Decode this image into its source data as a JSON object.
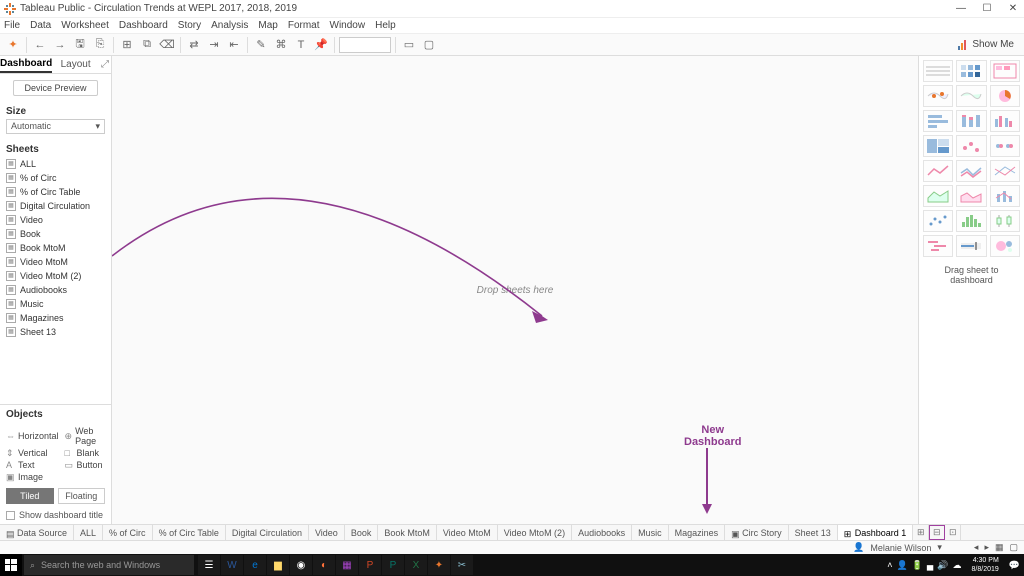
{
  "titlebar": {
    "app": "Tableau Public",
    "doc": "Circulation Trends at WEPL 2017, 2018, 2019"
  },
  "menu": [
    "File",
    "Data",
    "Worksheet",
    "Dashboard",
    "Story",
    "Analysis",
    "Map",
    "Format",
    "Window",
    "Help"
  ],
  "toolbar": {
    "showme": "Show Me"
  },
  "leftpanel": {
    "tabs": {
      "dashboard": "Dashboard",
      "layout": "Layout"
    },
    "device_preview": "Device Preview",
    "size_label": "Size",
    "size_value": "Automatic",
    "sheets_label": "Sheets",
    "sheets": [
      "ALL",
      "% of Circ",
      "% of Circ Table",
      "Digital Circulation",
      "Video",
      "Book",
      "Book MtoM",
      "Video MtoM",
      "Video MtoM (2)",
      "Audiobooks",
      "Music",
      "Magazines",
      "Sheet 13"
    ],
    "objects_label": "Objects",
    "objects": [
      {
        "label": "Horizontal",
        "icon": "⇔"
      },
      {
        "label": "Web Page",
        "icon": "⊕"
      },
      {
        "label": "Vertical",
        "icon": "⇕"
      },
      {
        "label": "Blank",
        "icon": "□"
      },
      {
        "label": "Text",
        "icon": "A"
      },
      {
        "label": "Button",
        "icon": "▭"
      },
      {
        "label": "Image",
        "icon": "▣"
      }
    ],
    "tiled": "Tiled",
    "floating": "Floating",
    "show_title": "Show dashboard title"
  },
  "canvas": {
    "drop_hint": "Drop sheets here"
  },
  "rightpanel": {
    "hint": "Drag sheet to dashboard"
  },
  "annotation": {
    "line1": "New",
    "line2": "Dashboard"
  },
  "sheettabs": {
    "data_source": "Data Source",
    "tabs": [
      "ALL",
      "% of Circ",
      "% of Circ Table",
      "Digital Circulation",
      "Video",
      "Book",
      "Book MtoM",
      "Video MtoM",
      "Video MtoM (2)",
      "Audiobooks",
      "Music",
      "Magazines"
    ],
    "story": "Circ Story",
    "sheet13": "Sheet 13",
    "active": "Dashboard 1"
  },
  "statusbar": {
    "user": "Melanie Wilson"
  },
  "taskbar": {
    "search_placeholder": "Search the web and Windows",
    "time": "4:30 PM",
    "date": "8/8/2019"
  },
  "colors": {
    "accent": "#8e3a8e"
  }
}
